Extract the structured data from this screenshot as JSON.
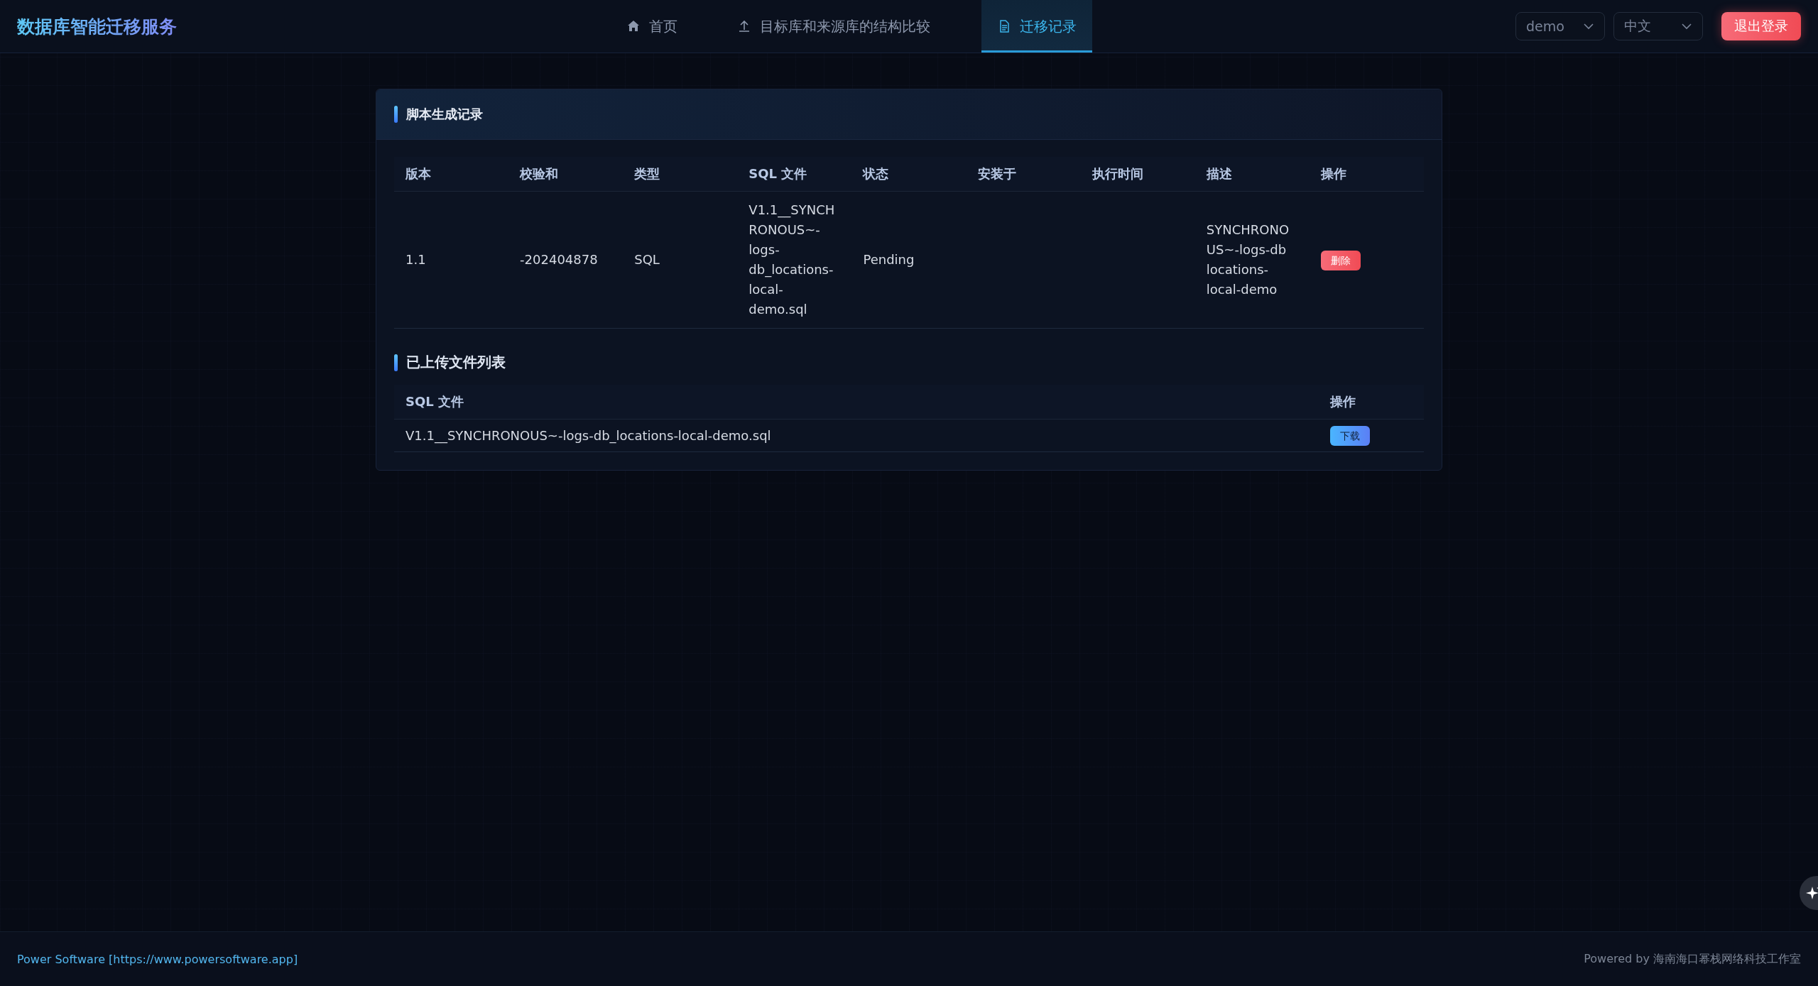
{
  "header": {
    "title": "数据库智能迁移服务",
    "nav": [
      {
        "label": "首页",
        "kind": "home",
        "selected": false
      },
      {
        "label": "目标库和来源库的结构比较",
        "kind": "compare",
        "selected": false
      },
      {
        "label": "迁移记录",
        "kind": "records",
        "selected": true
      }
    ],
    "user_select": {
      "value": "demo"
    },
    "language_select": {
      "value": "中文"
    },
    "logout_button": "退出登录"
  },
  "script_records": {
    "title": "脚本生成记录",
    "columns": [
      "版本",
      "校验和",
      "类型",
      "SQL 文件",
      "状态",
      "安装于",
      "执行时间",
      "描述",
      "操作"
    ],
    "rows": [
      {
        "version": "1.1",
        "checksum": "-202404878",
        "type": "SQL",
        "sql_file": "V1.1__SYNCHRONOUS~-logs-db_locations-local-demo.sql",
        "status": "Pending",
        "description": "SYNCHRONOUS~-logs-db locations-local-demo",
        "action": {
          "label": "删除",
          "kind": "danger"
        }
      }
    ]
  },
  "uploaded_files": {
    "title": "已上传文件列表",
    "columns": [
      "SQL 文件",
      "操作"
    ],
    "rows": [
      {
        "file": "V1.1__SYNCHRONOUS~-logs-db_locations-local-demo.sql",
        "action": {
          "label": "下载",
          "kind": "primary"
        }
      }
    ]
  },
  "footer": {
    "link": "Power Software [https://www.powersoftware.app]",
    "credit": "Powered by 海南海口幂栈网络科技工作室"
  }
}
